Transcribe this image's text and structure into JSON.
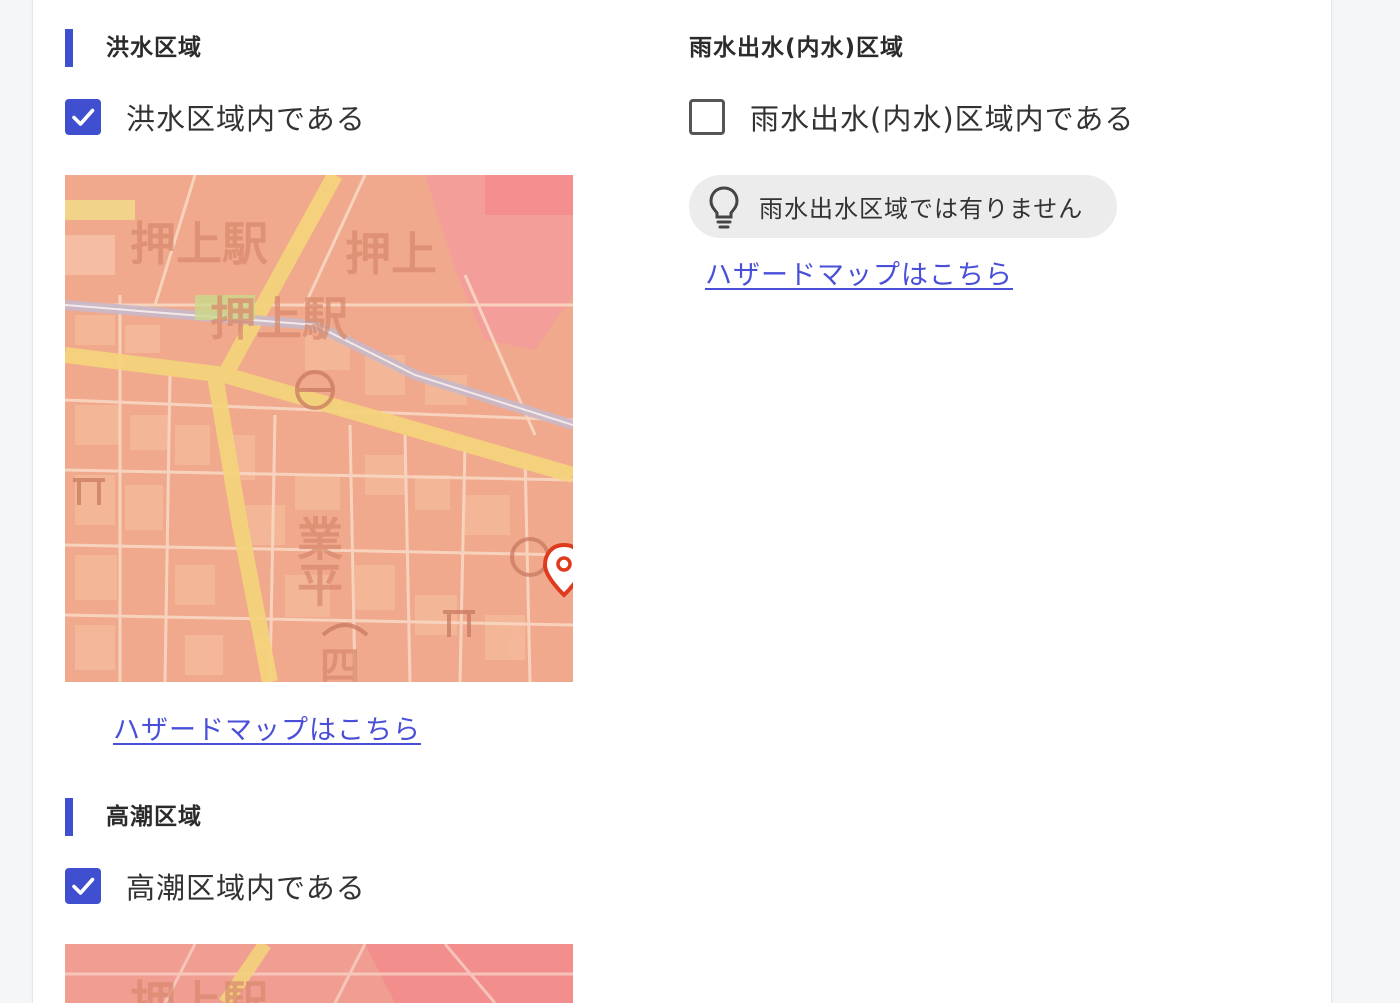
{
  "flood": {
    "title": "洪水区域",
    "checkbox_label": "洪水区域内である",
    "checked": true,
    "map_labels": [
      "押上駅",
      "押上",
      "押上駅",
      "業平",
      "四"
    ],
    "link": "ハザードマップはこちら"
  },
  "high_tide": {
    "title": "高潮区域",
    "checkbox_label": "高潮区域内である",
    "checked": true,
    "map_labels": [
      "押上駅"
    ]
  },
  "inland_flood": {
    "title": "雨水出水(内水)区域",
    "checkbox_label": "雨水出水(内水)区域内である",
    "checked": false,
    "info_text": "雨水出水区域では有りません",
    "link": "ハザードマップはこちら"
  },
  "colors": {
    "accent": "#3f4fcf",
    "link": "#4a4fd8",
    "map_base": "#f0a98c",
    "pin": "#e03a1e"
  }
}
